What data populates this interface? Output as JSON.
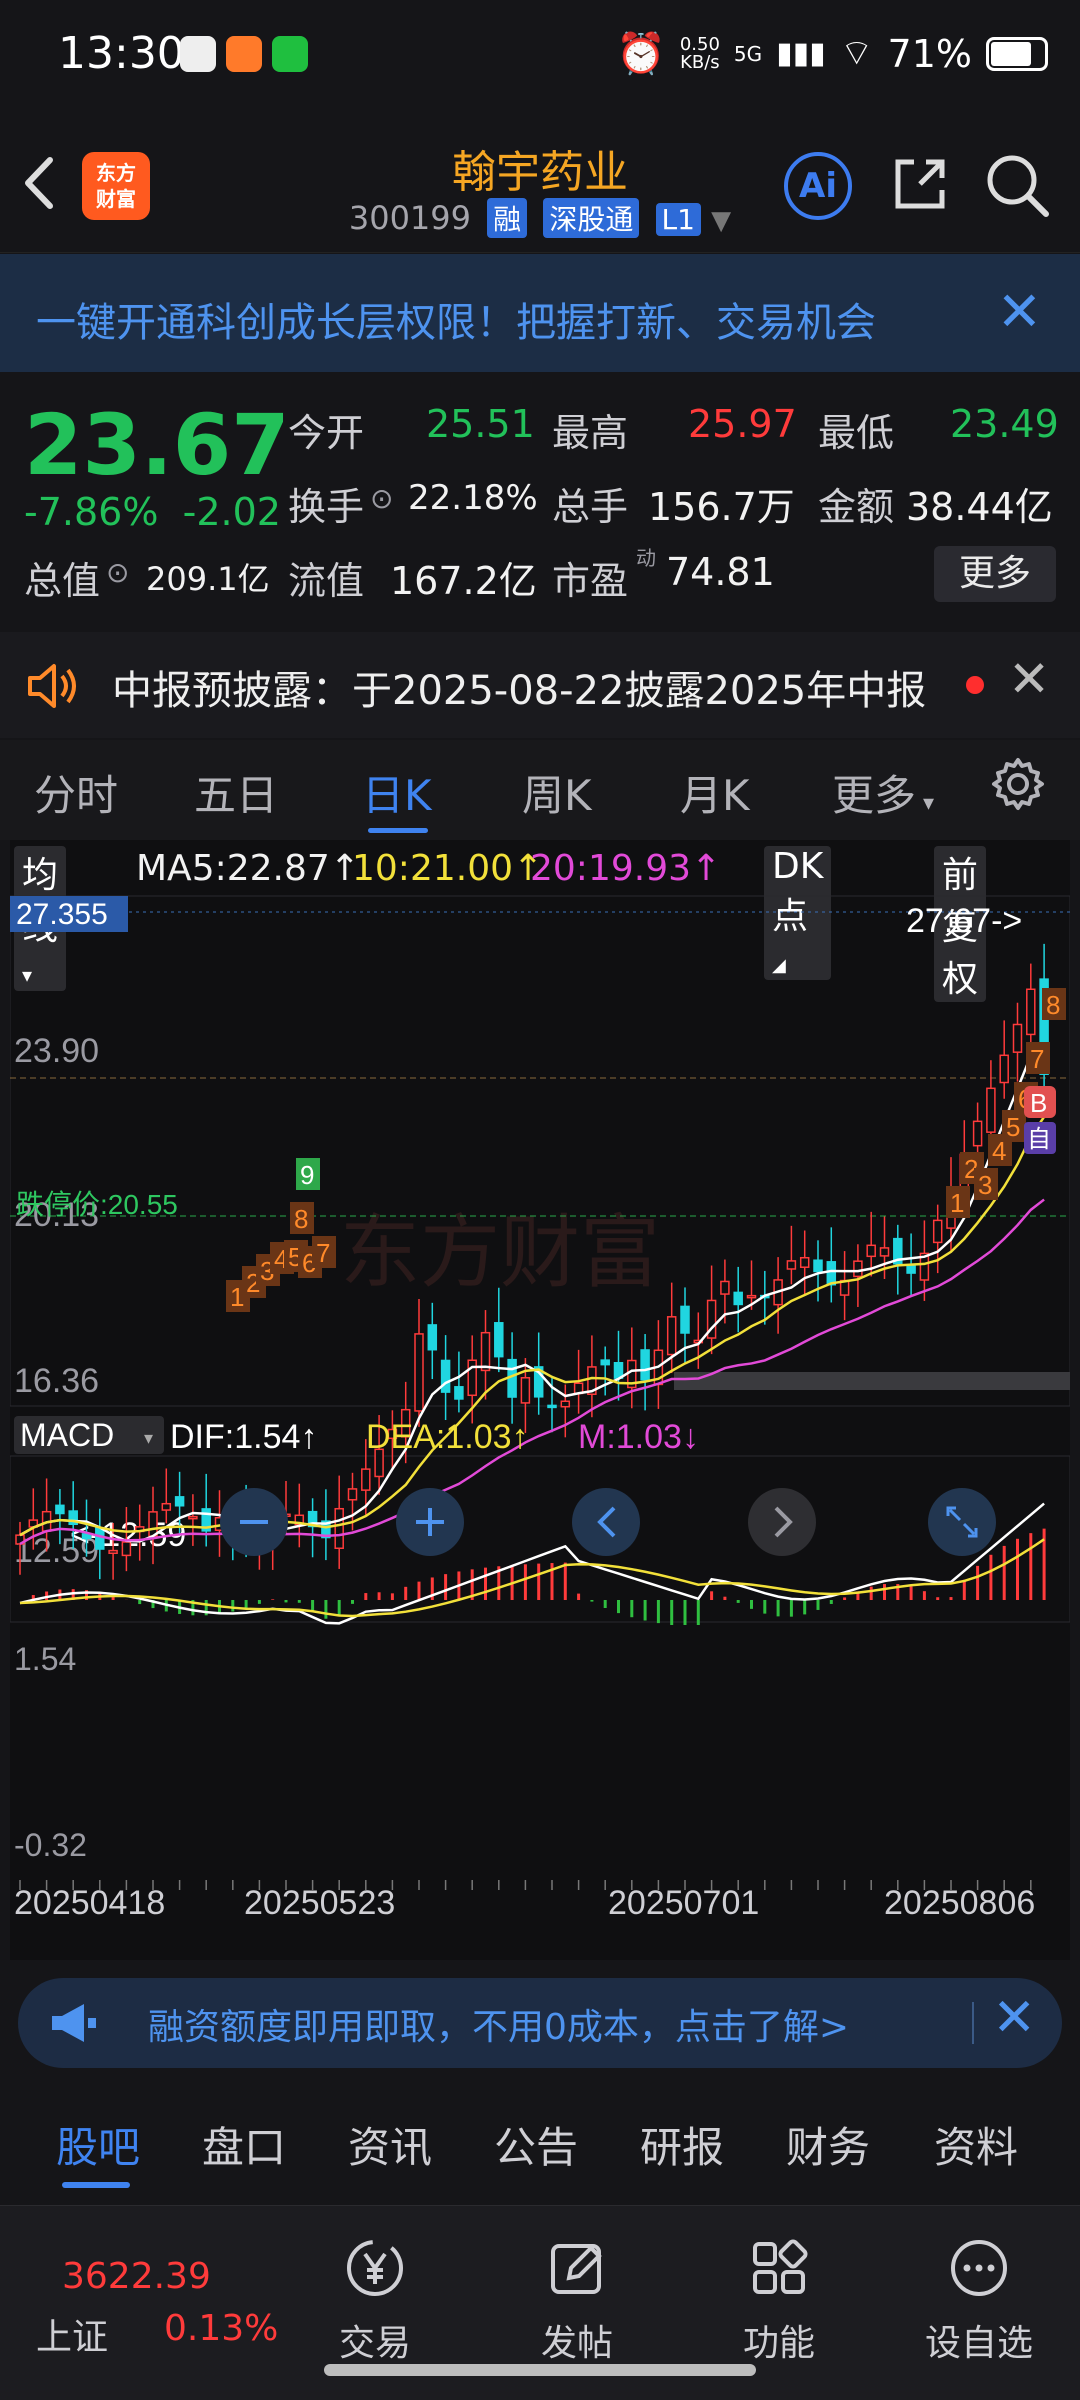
{
  "status_bar": {
    "time": "13:30",
    "speed_top": "0.50",
    "speed_unit": "KB/s",
    "network": "5G",
    "battery": "71%"
  },
  "header": {
    "logo_line1": "东方",
    "logo_line2": "财富",
    "title": "翰宇药业",
    "code": "300199",
    "tags": [
      "融",
      "深股通",
      "L1"
    ],
    "ai_label": "Ai"
  },
  "banner": {
    "text": "一键开通科创成长层权限！把握打新、交易机会"
  },
  "quote": {
    "price": "23.67",
    "change_pct": "-7.86%",
    "change": "-2.02",
    "open_label": "今开",
    "open": "25.51",
    "high_label": "最高",
    "high": "25.97",
    "low_label": "最低",
    "low": "23.49",
    "turnover_label": "换手",
    "turnover": "22.18%",
    "volume_label": "总手",
    "volume": "156.7万",
    "amount_label": "金额",
    "amount": "38.44亿",
    "mcap_label": "总值",
    "mcap": "209.1亿",
    "float_label": "流值",
    "float": "167.2亿",
    "pe_label": "市盈",
    "pe_sup": "动",
    "pe": "74.81",
    "more": "更多"
  },
  "notice": {
    "text": "中报预披露：于2025-08-22披露2025年中报"
  },
  "ktabs": [
    "分时",
    "五日",
    "日K",
    "周K",
    "月K",
    "更多"
  ],
  "chart_controls": {
    "ma_select": "均线",
    "ma5": "MA5:22.87",
    "ma10": "10:21.00",
    "ma20": "20:19.93",
    "dk": "DK点",
    "adjust": "前复权",
    "macd_select": "MACD",
    "dif": "DIF:1.54",
    "dea": "DEA:1.03",
    "m": "M:1.03"
  },
  "chart_data": {
    "type": "candlestick",
    "y_ticks": [
      "27.355",
      "23.90",
      "20.13",
      "16.36",
      "12.59"
    ],
    "limit_down_label": "跌停价:20.55",
    "last_marker": "27.67->",
    "low_marker": "12.59",
    "dates": [
      "20250418",
      "20250523",
      "20250701",
      "20250806"
    ],
    "macd_ticks": [
      "1.54",
      "-0.32"
    ],
    "signal_marks": [
      "1",
      "2",
      "3",
      "4",
      "5",
      "6",
      "7",
      "8",
      "9",
      "1",
      "2",
      "3",
      "4",
      "5",
      "6",
      "7",
      "8"
    ],
    "colors": {
      "up": "#ff3b3b",
      "down": "#20d6e0",
      "ma5": "#ffffff",
      "ma10": "#f2e03a",
      "ma20": "#e24ad8"
    },
    "watermark": "东方财富"
  },
  "promo": {
    "text": "融资额度即用即取，不用0成本，点击了解>"
  },
  "section_tabs": [
    "股吧",
    "盘口",
    "资讯",
    "公告",
    "研报",
    "财务",
    "资料"
  ],
  "bottom_bar": {
    "index_value": "3622.39",
    "index_name": "上证",
    "index_pct": "0.13%",
    "items": [
      "交易",
      "发帖",
      "功能",
      "设自选"
    ]
  },
  "colors": {
    "accent": "#3f83f0",
    "up": "#ff3b3b",
    "down": "#22c15a",
    "brand": "#ff5a1f"
  }
}
